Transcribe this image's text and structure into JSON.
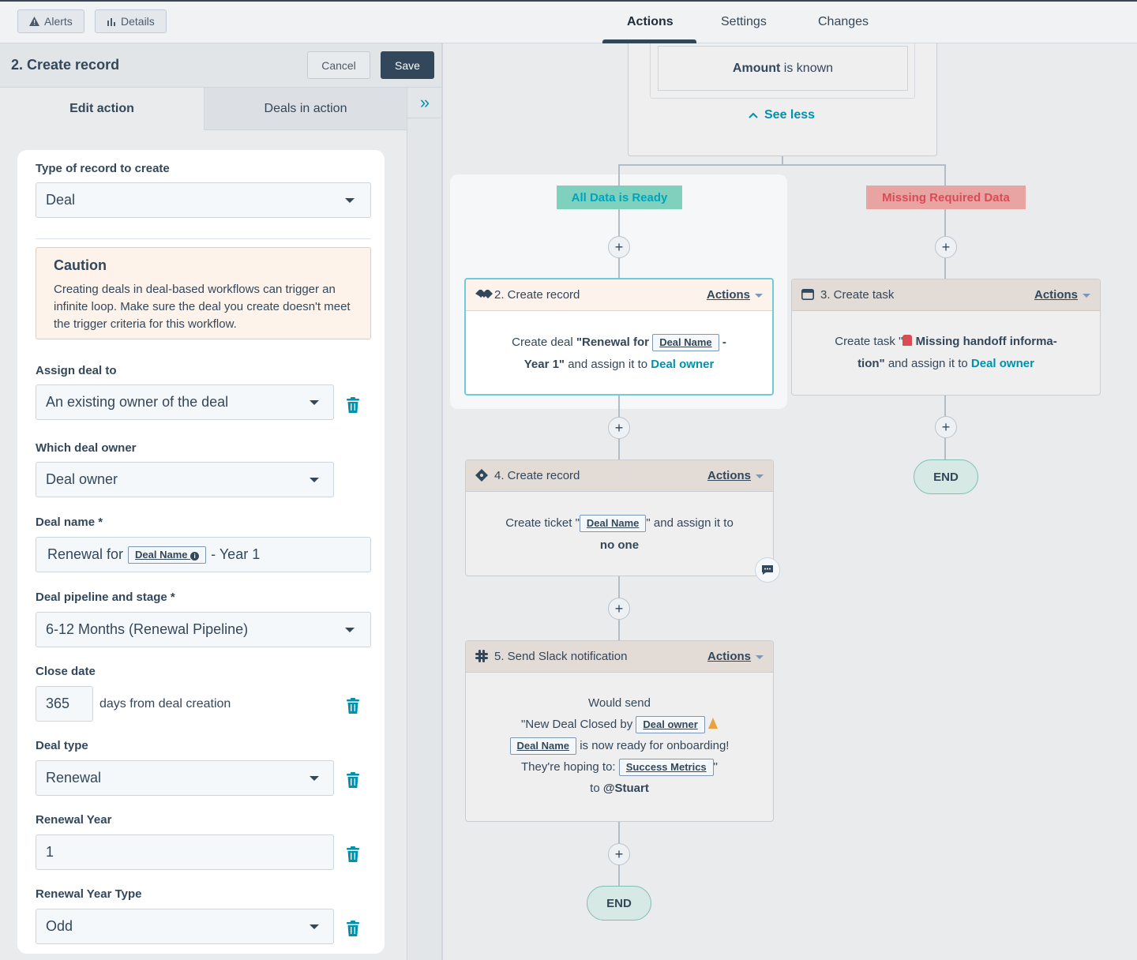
{
  "topbar": {
    "alerts_label": "Alerts",
    "details_label": "Details",
    "tabs": [
      {
        "label": "Actions",
        "active": true
      },
      {
        "label": "Settings",
        "active": false
      },
      {
        "label": "Changes",
        "active": false
      }
    ]
  },
  "panel": {
    "title": "2. Create record",
    "cancel_label": "Cancel",
    "save_label": "Save",
    "tabs": [
      "Edit action",
      "Deals in action"
    ],
    "collapse_icon": "double-chevron-right-icon"
  },
  "form": {
    "record_type_label": "Type of record to create",
    "record_type_value": "Deal",
    "caution_title": "Caution",
    "caution_text": "Creating deals in deal-based workflows can trigger an infinite loop. Make sure the deal you create doesn't meet the trigger criteria for this workflow.",
    "assign_label": "Assign deal to",
    "assign_value": "An existing owner of the deal",
    "which_owner_label": "Which deal owner",
    "which_owner_value": "Deal owner",
    "deal_name_label": "Deal name *",
    "deal_name_prefix": "Renewal for",
    "deal_name_token": "Deal Name",
    "deal_name_suffix": "- Year 1",
    "pipeline_label": "Deal pipeline and stage *",
    "pipeline_value": "6-12 Months (Renewal Pipeline)",
    "close_date_label": "Close date",
    "close_date_value": "365",
    "close_date_suffix": "days from deal creation",
    "deal_type_label": "Deal type",
    "deal_type_value": "Renewal",
    "renewal_year_label": "Renewal Year",
    "renewal_year_value": "1",
    "renewal_year_type_label": "Renewal Year Type",
    "renewal_year_type_value": "Odd"
  },
  "canvas": {
    "top_card": {
      "condition_bold": "Amount",
      "condition_rest": " is known",
      "see_less": "See less"
    },
    "branch_ready": "All Data is Ready",
    "branch_missing": "Missing Required Data",
    "card2": {
      "title": "2. Create record",
      "actions": "Actions",
      "l1_pre": "Create deal ",
      "l1_bold": "\"Renewal for",
      "token": "Deal Name",
      "l1_post": " -",
      "l2_bold": "Year 1\"",
      "l2_mid": " and assign it to ",
      "l2_link": "Deal owner"
    },
    "card3": {
      "title": "3. Create task",
      "actions": "Actions",
      "l1_pre": "Create task \"",
      "l1_bold": " Missing handoff informa-",
      "l2_bold": "tion\"",
      "l2_mid": " and assign it to ",
      "l2_link": "Deal owner"
    },
    "card4": {
      "title": "4. Create record",
      "actions": "Actions",
      "l1_pre": "Create ticket \"",
      "token": "Deal Name",
      "l1_post": "\" and assign it to",
      "l2_bold": "no one"
    },
    "card5": {
      "title": "5. Send Slack notification",
      "actions": "Actions",
      "l1": "Would send",
      "l2_pre": "\"New Deal Closed by",
      "l2_token": "Deal owner",
      "l3_token": "Deal Name",
      "l3_post": "is now ready for onboarding!",
      "l4_pre": "They're hoping to:",
      "l4_token": "Success Metrics",
      "l4_post": "\"",
      "l5_pre": "to ",
      "l5_bold": "@Stuart"
    },
    "end_label": "END",
    "plus_label": "+"
  },
  "colors": {
    "ready_badge_bg": "#7fd1bd",
    "ready_badge_text": "#00a4bd",
    "missing_badge_bg": "#e8a3a3",
    "missing_badge_text": "#d94c53",
    "link": "#0091ae",
    "save_bg": "#33475b"
  }
}
